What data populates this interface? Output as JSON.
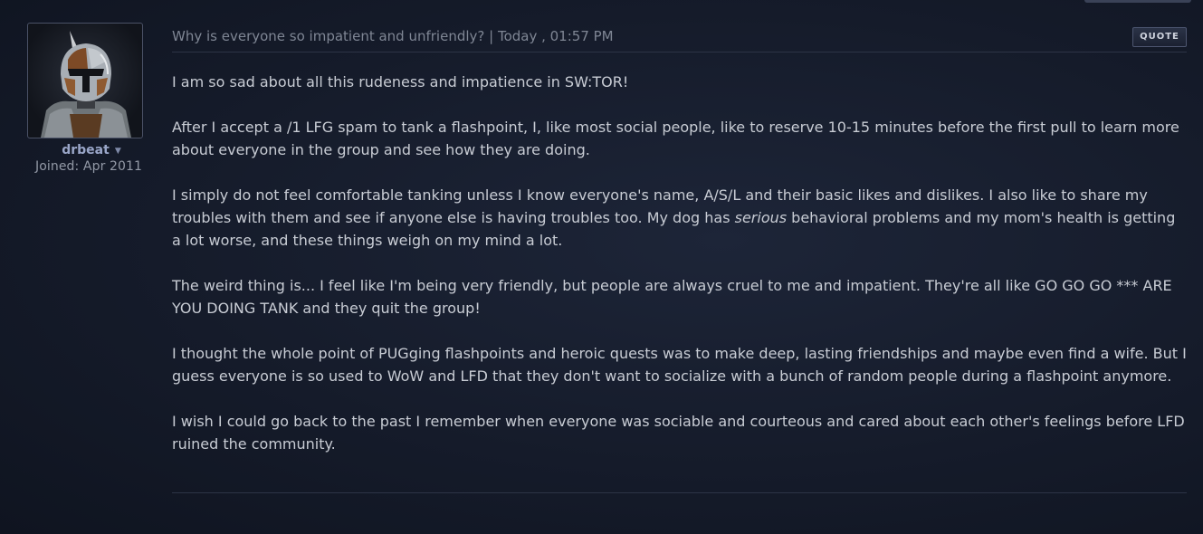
{
  "author": {
    "avatar_icon": "armored-helmet-avatar",
    "username": "drbeat",
    "caret": "▼",
    "joined": "Joined: Apr 2011"
  },
  "post": {
    "title": "Why is everyone so impatient and unfriendly? | Today , 01:57 PM",
    "quote_label": "QUOTE",
    "paragraphs": [
      "I am so sad about all this rudeness and impatience in SW:TOR!",
      "After I accept a /1 LFG spam to tank a flashpoint, I, like most social people, like to reserve 10-15 minutes before the first pull to learn more about everyone in the group and see how they are doing.",
      {
        "before": "I simply do not feel comfortable tanking unless I know everyone's name, A/S/L and their basic likes and dislikes. I also like to share my troubles with them and see if anyone else is having troubles too. My dog has ",
        "emphasis": "serious",
        "after": " behavioral problems and my mom's health is getting a lot worse, and these things weigh on my mind a lot."
      },
      "The weird thing is... I feel like I'm being very friendly, but people are always cruel to me and impatient. They're all like GO GO GO *** ARE YOU DOING TANK and they quit the group!",
      "I thought the whole point of PUGging flashpoints and heroic quests was to make deep, lasting friendships and maybe even find a wife. But I guess everyone is so used to WoW and LFD that they don't want to socialize with a bunch of random people during a flashpoint anymore.",
      "I wish I could go back to the past I remember when everyone was sociable and courteous and cared about each other's feelings before LFD ruined the community."
    ]
  },
  "colors": {
    "background": "#151b2a",
    "text": "#c8ccd4",
    "username": "#9aa6c8",
    "muted": "#7f8694",
    "divider": "#2d3446"
  }
}
